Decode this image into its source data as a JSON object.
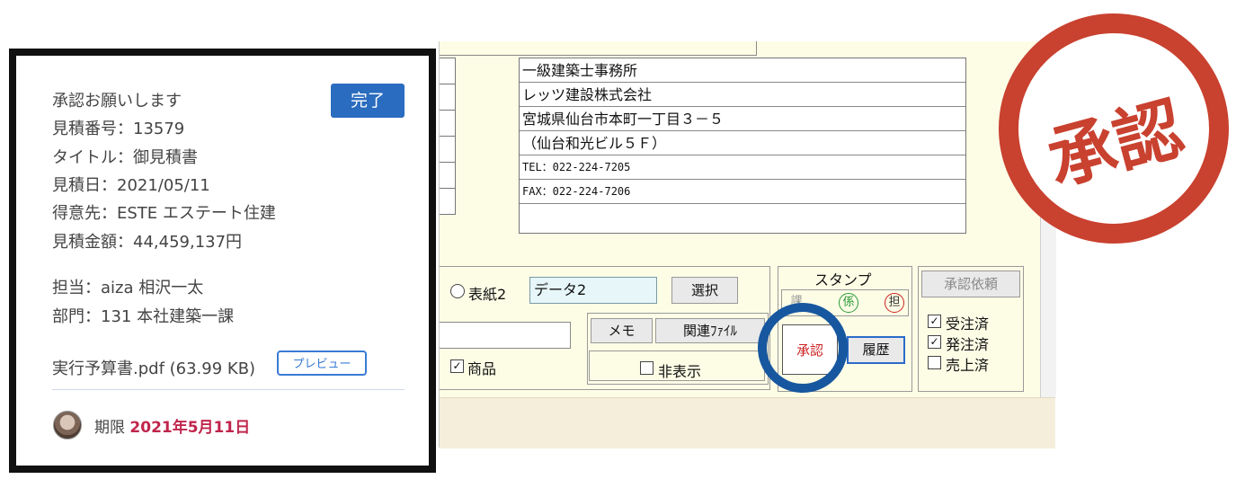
{
  "card": {
    "request_title": "承認お願いします",
    "done_button": "完了",
    "quote_number": "見積番号：13579",
    "title": "タイトル：御見積書",
    "quote_date": "見積日：2021/05/11",
    "customer": "得意先：ESTE エステート住建",
    "amount": "見積金額：44,459,137円",
    "person": "担当：aiza 相沢一太",
    "department": "部門：131 本社建築一課",
    "attachment": "実行予算書.pdf (63.99 KB)",
    "preview_button": "プレビュー",
    "deadline_label": "期限",
    "deadline_value": "2021年5月11日"
  },
  "window": {
    "address": [
      "一級建築士事務所",
      "レッツ建設株式会社",
      "宮城県仙台市本町一丁目３－５",
      "（仙台和光ビル５Ｆ）",
      "TEL：022-224-7205",
      "FAX：022-224-7206",
      ""
    ],
    "cover_label": "表紙2",
    "data_value": "データ2",
    "select_button": "選択",
    "stamp_label": "スタンプ",
    "stamp_chars": [
      "課",
      "係",
      "担"
    ],
    "approval_request_button": "承認依頼",
    "memo_button": "メモ",
    "related_file_button": "関連ﾌｧｲﾙ",
    "product_label": "商品",
    "hide_label": "非表示",
    "approve_stamp": "承認",
    "history_button": "履歴",
    "status_checks": [
      {
        "label": "受注済",
        "checked": true
      },
      {
        "label": "発注済",
        "checked": true
      },
      {
        "label": "売上済",
        "checked": false
      }
    ]
  },
  "seal": {
    "text": "承認"
  },
  "colors": {
    "brand_blue": "#2a6cbf",
    "deadline_red": "#c0254c",
    "seal_red": "#c9412f",
    "highlight_blue": "#17579f"
  }
}
